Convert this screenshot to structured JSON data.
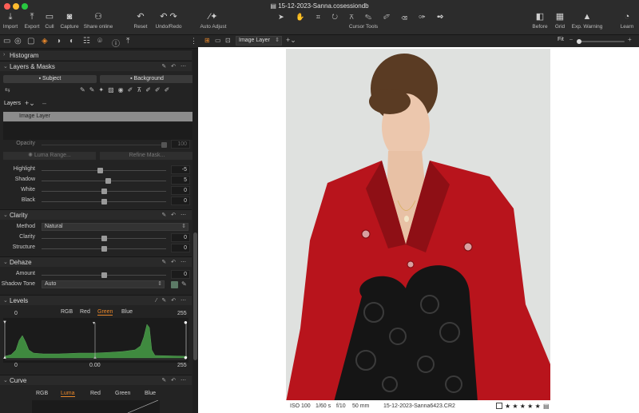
{
  "window": {
    "title": "15-12-2023-Sanna.cosessiondb"
  },
  "toolbar": {
    "import": "Import",
    "export": "Export",
    "cull": "Cull",
    "capture": "Capture",
    "share_online": "Share online",
    "reset": "Reset",
    "undo_redo": "Undo/Redo",
    "auto_adjust": "Auto Adjust",
    "cursor_tools": "Cursor Tools",
    "before": "Before",
    "grid": "Grid",
    "exp_warning": "Exp. Warning",
    "learn": "Learn"
  },
  "viewer_toolbar": {
    "layer_select": "Image Layer",
    "zoom": "Fit"
  },
  "panels": {
    "histogram": {
      "title": "Histogram"
    },
    "layers_masks": {
      "title": "Layers & Masks",
      "subject_button": "Subject",
      "background_button": "Background",
      "layers_label": "Layers",
      "layer_name": "Image Layer",
      "opacity_label": "Opacity",
      "opacity_value": "100",
      "luma_range": "Luma Range...",
      "refine_mask": "Refine Mask..."
    },
    "hdr": {
      "highlight_label": "Highlight",
      "highlight_value": "-5",
      "highlight_pct": 47,
      "shadow_label": "Shadow",
      "shadow_value": "5",
      "shadow_pct": 53,
      "white_label": "White",
      "white_value": "0",
      "white_pct": 50,
      "black_label": "Black",
      "black_value": "0",
      "black_pct": 50
    },
    "clarity": {
      "title": "Clarity",
      "method_label": "Method",
      "method_value": "Natural",
      "clarity_label": "Clarity",
      "clarity_value": "0",
      "clarity_pct": 50,
      "structure_label": "Structure",
      "structure_value": "0",
      "structure_pct": 50
    },
    "dehaze": {
      "title": "Dehaze",
      "amount_label": "Amount",
      "amount_value": "0",
      "amount_pct": 50,
      "shadow_tone_label": "Shadow Tone",
      "shadow_tone_value": "Auto",
      "swatch_color": "#5c7a66"
    },
    "levels": {
      "title": "Levels",
      "channels": [
        "RGB",
        "Red",
        "Green",
        "Blue"
      ],
      "active_channel": "Green",
      "input_low": "0",
      "input_high": "255",
      "output_low": "0",
      "midtone": "0.00",
      "output_high": "255"
    },
    "curve": {
      "title": "Curve",
      "channels": [
        "RGB",
        "Luma",
        "Red",
        "Green",
        "Blue"
      ],
      "active_channel": "Luma"
    }
  },
  "colors": {
    "accent": "#e8872a",
    "histogram": "#3f8a3f",
    "jacket": "#b8141c"
  },
  "image_info": {
    "iso": "ISO 100",
    "shutter": "1/60 s",
    "aperture": "f/10",
    "focal": "50 mm",
    "filename": "15-12-2023-Sanna6423.CR2",
    "stars": "★ ★ ★ ★ ★"
  }
}
